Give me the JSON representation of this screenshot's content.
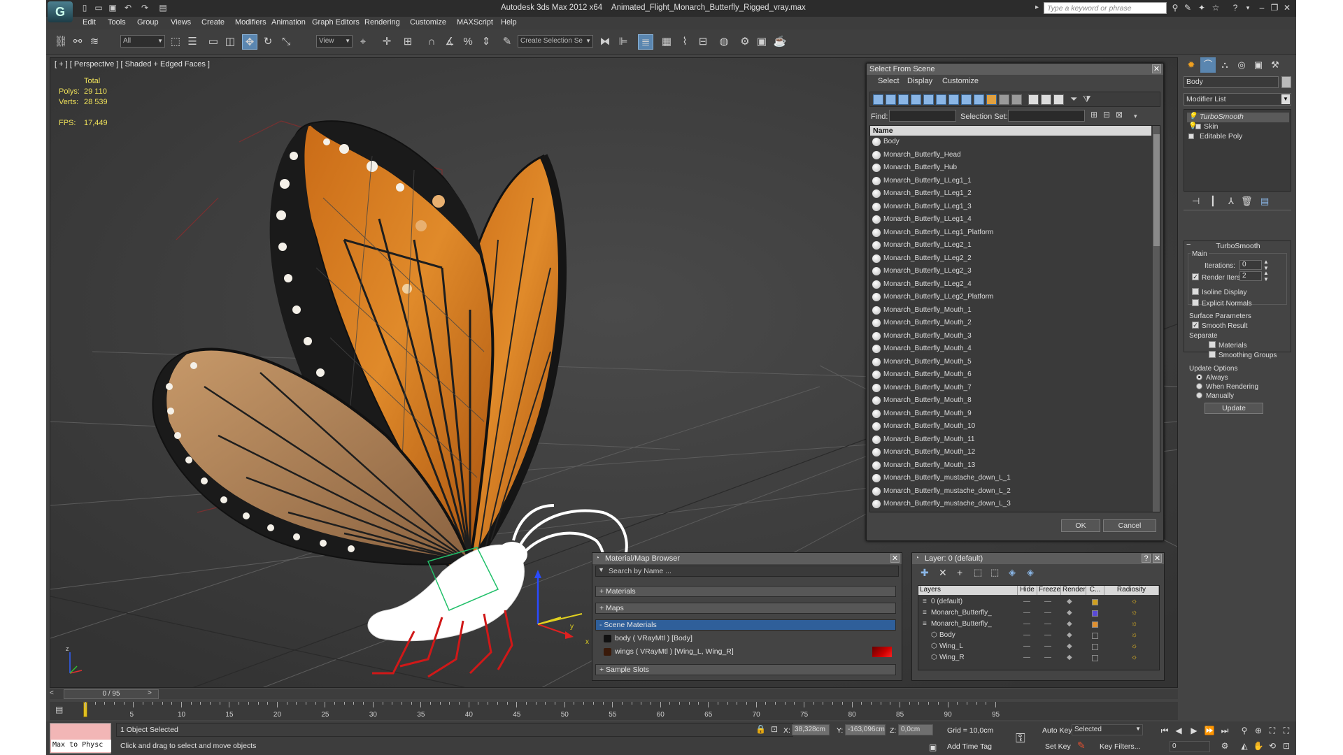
{
  "title_bar": {
    "app": "Autodesk 3ds Max  2012 x64",
    "file": "Animated_Flight_Monarch_Butterfly_Rigged_vray.max",
    "search_placeholder": "Type a keyword or phrase"
  },
  "menu": [
    "Edit",
    "Tools",
    "Group",
    "Views",
    "Create",
    "Modifiers",
    "Animation",
    "Graph Editors",
    "Rendering",
    "Customize",
    "MAXScript",
    "Help"
  ],
  "toolbar": {
    "filter_value": "All",
    "ref_coord_value": "View",
    "selection_set_placeholder": "Create Selection Se"
  },
  "viewport": {
    "label": "[ + ] [ Perspective ] [ Shaded + Edged Faces ]",
    "stats": {
      "total_label": "Total",
      "polys_label": "Polys:",
      "polys_value": "29 110",
      "verts_label": "Verts:",
      "verts_value": "28 539",
      "fps_label": "FPS:",
      "fps_value": "17,449"
    },
    "gizmo_labels": {
      "x": "x",
      "y": "y",
      "z": "z"
    }
  },
  "select_from_scene": {
    "title": "Select From Scene",
    "tabs": [
      "Select",
      "Display",
      "Customize"
    ],
    "find_label": "Find:",
    "selection_set_label": "Selection Set:",
    "column_name": "Name",
    "items": [
      "Body",
      "Monarch_Butterfly_Head",
      "Monarch_Butterfly_Hub",
      "Monarch_Butterfly_LLeg1_1",
      "Monarch_Butterfly_LLeg1_2",
      "Monarch_Butterfly_LLeg1_3",
      "Monarch_Butterfly_LLeg1_4",
      "Monarch_Butterfly_LLeg1_Platform",
      "Monarch_Butterfly_LLeg2_1",
      "Monarch_Butterfly_LLeg2_2",
      "Monarch_Butterfly_LLeg2_3",
      "Monarch_Butterfly_LLeg2_4",
      "Monarch_Butterfly_LLeg2_Platform",
      "Monarch_Butterfly_Mouth_1",
      "Monarch_Butterfly_Mouth_2",
      "Monarch_Butterfly_Mouth_3",
      "Monarch_Butterfly_Mouth_4",
      "Monarch_Butterfly_Mouth_5",
      "Monarch_Butterfly_Mouth_6",
      "Monarch_Butterfly_Mouth_7",
      "Monarch_Butterfly_Mouth_8",
      "Monarch_Butterfly_Mouth_9",
      "Monarch_Butterfly_Mouth_10",
      "Monarch_Butterfly_Mouth_11",
      "Monarch_Butterfly_Mouth_12",
      "Monarch_Butterfly_Mouth_13",
      "Monarch_Butterfly_mustache_down_L_1",
      "Monarch_Butterfly_mustache_down_L_2",
      "Monarch_Butterfly_mustache_down_L_3"
    ],
    "ok_label": "OK",
    "cancel_label": "Cancel"
  },
  "material_browser": {
    "title": "Material/Map Browser",
    "search_placeholder": "Search by Name ...",
    "sections": {
      "materials": "+ Materials",
      "maps": "+ Maps",
      "scene_materials": "- Scene Materials",
      "sample_slots": "+ Sample Slots"
    },
    "scene_items": [
      "body  ( VRayMtl ) [Body]",
      "wings  ( VRayMtl ) [Wing_L, Wing_R]"
    ]
  },
  "layer_dialog": {
    "title": "Layer: 0 (default)",
    "columns": [
      "Layers",
      "Hide",
      "Freeze",
      "Render",
      "C...",
      "Radiosity"
    ],
    "rows": [
      {
        "name": "0 (default)",
        "indent": 0,
        "swatch": "#d0a020"
      },
      {
        "name": "Monarch_Butterfly_",
        "indent": 0,
        "swatch": "#5a4ad8"
      },
      {
        "name": "Monarch_Butterfly_",
        "indent": 0,
        "swatch": "#e09030"
      },
      {
        "name": "Body",
        "indent": 1,
        "swatch": ""
      },
      {
        "name": "Wing_L",
        "indent": 1,
        "swatch": ""
      },
      {
        "name": "Wing_R",
        "indent": 1,
        "swatch": ""
      }
    ]
  },
  "command_panel": {
    "object_name": "Body",
    "modifier_list": "Modifier List",
    "stack": [
      "TurboSmooth",
      "Skin",
      "Editable Poly"
    ],
    "rollout_title": "TurboSmooth",
    "main_label": "Main",
    "iterations_label": "Iterations:",
    "iterations_value": "0",
    "render_iters_label": "Render Iters:",
    "render_iters_value": "2",
    "isoline_label": "Isoline Display",
    "explicit_normals_label": "Explicit Normals",
    "surface_params_label": "Surface Parameters",
    "smooth_result_label": "Smooth Result",
    "separate_label": "Separate",
    "materials_label": "Materials",
    "smoothing_groups_label": "Smoothing Groups",
    "update_options_label": "Update Options",
    "always_label": "Always",
    "when_rendering_label": "When Rendering",
    "manually_label": "Manually",
    "update_button": "Update"
  },
  "timeline": {
    "slider_label": "0 / 95",
    "ticks": [
      "5",
      "10",
      "15",
      "20",
      "25",
      "30",
      "35",
      "40",
      "45",
      "50",
      "55",
      "60",
      "65",
      "70",
      "75",
      "80",
      "85",
      "90",
      "95"
    ]
  },
  "status": {
    "listener_text": "Max to Physc",
    "selection_info": "1 Object Selected",
    "prompt": "Click and drag to select and move objects",
    "x_label": "X:",
    "x_value": "38,328cm",
    "y_label": "Y:",
    "y_value": "-163,096cm",
    "z_label": "Z:",
    "z_value": "0,0cm",
    "grid": "Grid = 10,0cm",
    "add_time_tag": "Add Time Tag",
    "auto_key": "Auto Key",
    "set_key": "Set Key",
    "key_mode_value": "Selected",
    "key_filters": "Key Filters...",
    "frame_value": "0"
  }
}
